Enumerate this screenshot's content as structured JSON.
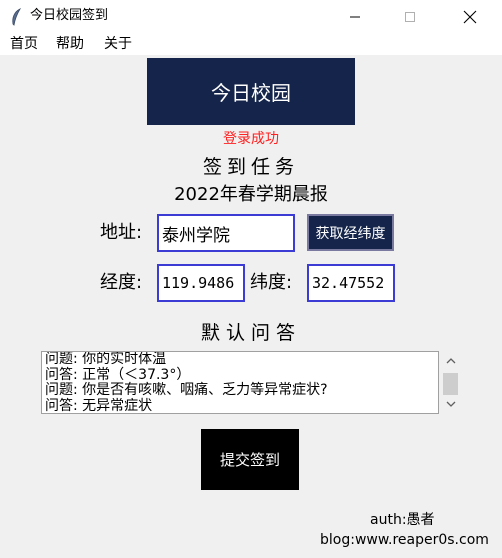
{
  "window": {
    "title": "今日校园签到"
  },
  "menu": {
    "items": [
      "首页",
      "帮助",
      "关于"
    ]
  },
  "banner": {
    "title": "今日校园"
  },
  "status": {
    "login": "登录成功"
  },
  "task": {
    "title": "签到任务",
    "term": "2022年春学期晨报"
  },
  "address": {
    "label": "地址:",
    "value": "泰州学院",
    "geo_button": "获取经纬度"
  },
  "coords": {
    "lng_label": "经度:",
    "lng_value": "119.9486",
    "lat_label": "纬度:",
    "lat_value": "32.47552"
  },
  "qa": {
    "title": "默认问答",
    "lines": [
      "问题: 你的实时体温",
      "问答: 正常（＜37.3°）",
      "问题: 你是否有咳嗽、咽痛、乏力等异常症状?",
      "问答: 无异常症状"
    ]
  },
  "submit": {
    "label": "提交签到"
  },
  "footer": {
    "author": "auth:愚者",
    "blog": "blog:www.reaper0s.com"
  },
  "colors": {
    "banner_bg": "#14244a",
    "status_text": "#ff2020",
    "entry_border": "#3c3cd4"
  }
}
